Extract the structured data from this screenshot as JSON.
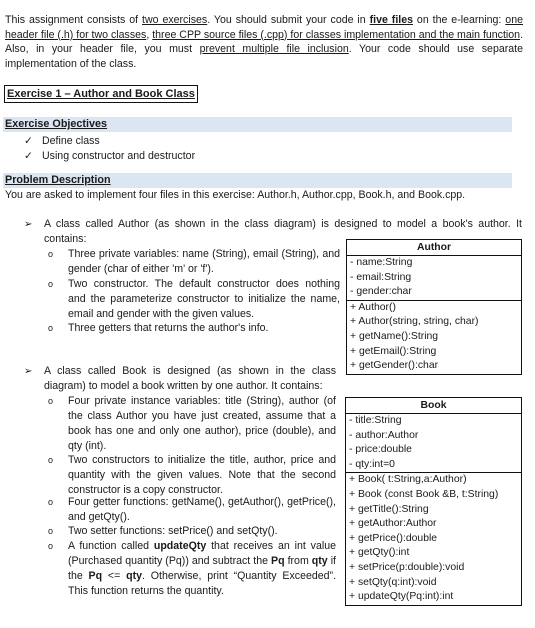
{
  "intro": {
    "t1": "This assignment consists of ",
    "u1": "two exercises",
    "t2": ". You should submit your code in ",
    "b1": "five files",
    "t3": " on the e-learning: ",
    "u2": "one header file (.h) for two classes",
    "t4": ", ",
    "u3": "three CPP source files (.cpp) for classes implementation and the main function",
    "t5": ". Also, in your header file, you must ",
    "u4": "prevent multiple file inclusion",
    "t6": ". Your code should use separate implementation of the class."
  },
  "exercise_title": "Exercise 1 – Author and Book Class",
  "objectives": {
    "heading": "Exercise Objectives",
    "check_icon": "✓",
    "items": [
      "Define class",
      "Using constructor and destructor"
    ]
  },
  "problem": {
    "heading": "Problem Description",
    "text": "You are asked to implement four files in this exercise: Author.h, Author.cpp, Book.h, and Book.cpp."
  },
  "bullets": {
    "arrow_icon": "➢",
    "circle_icon": "o"
  },
  "author_section": {
    "lead_a": "A class called Author (as shown in the class diagram) is designed to model a book's author. It",
    "lead_b": "contains:",
    "items": [
      "Three private variables: name (String), email (String), and gender (char of either 'm' or 'f').",
      "Two constructor. The default constructor does nothing and the parameterize constructor to initialize the name, email and gender with the given values.",
      "Three getters that returns the author's info."
    ]
  },
  "book_section": {
    "lead": "A class called Book is designed (as shown in the class diagram) to model a book written by one author. It contains:",
    "items": [
      "Four private instance variables: title (String), author (of the class Author you have just created, assume that a book has one and only one author), price (double), and qty (int).",
      "Two constructors to initialize the title, author, price and quantity with the given values. Note that the second constructor is a copy constructor.",
      "Four getter functions: getName(), getAuthor(), getPrice(), and getQty().",
      "Two setter functions: setPrice() and setQty()."
    ],
    "last_item": {
      "t1": "A function called ",
      "b1": "updateQty",
      "t2": " that receives an int value (Purchased quantity (Pq)) and subtract the ",
      "b2": "Pq",
      "t3": " from ",
      "b3": "qty",
      "t4": " if the ",
      "b4": "Pq",
      "t5": " <= ",
      "b5": "qty",
      "t6": ". Otherwise, print “Quantity Exceeded”. This function returns the quantity."
    }
  },
  "author_uml": {
    "name": "Author",
    "attributes": [
      "- name:String",
      "- email:String",
      "- gender:char"
    ],
    "operations": [
      "+ Author()",
      "+ Author(string, string, char)",
      "+ getName():String",
      "+ getEmail():String",
      "+ getGender():char"
    ]
  },
  "book_uml": {
    "name": "Book",
    "attributes": [
      "- title:String",
      "- author:Author",
      "- price:double",
      "- qty:int=0"
    ],
    "operations": [
      "+ Book( t:String,a:Author)",
      "+ Book (const Book &B, t:String)",
      "+ getTitle():String",
      "+ getAuthor:Author",
      "+ getPrice():double",
      "+ getQty():int",
      "+ setPrice(p:double):void",
      "+ setQty(q:int):void",
      "+ updateQty(Pq:int):int"
    ]
  }
}
